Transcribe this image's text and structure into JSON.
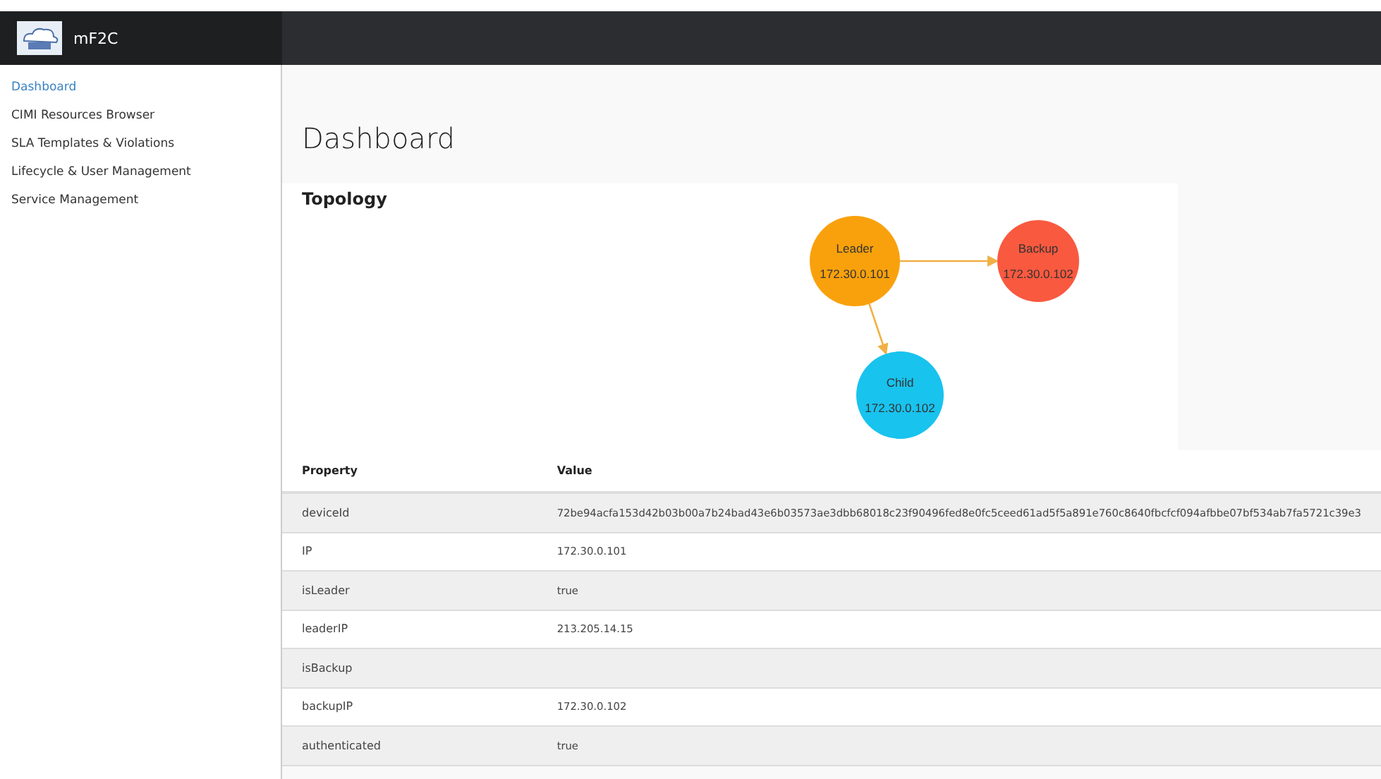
{
  "app": {
    "title": "mF2C"
  },
  "sidebar": {
    "items": [
      {
        "label": "Dashboard",
        "selected": true
      },
      {
        "label": "CIMI Resources Browser",
        "selected": false
      },
      {
        "label": "SLA Templates & Violations",
        "selected": false
      },
      {
        "label": "Lifecycle & User Management",
        "selected": false
      },
      {
        "label": "Service Management",
        "selected": false
      }
    ]
  },
  "page_title": "Dashboard",
  "topology": {
    "title": "Topology",
    "nodes": [
      {
        "kind": "leader",
        "label": "Leader",
        "ip": "172.30.0.101",
        "color": "#f9a10c"
      },
      {
        "kind": "backup",
        "label": "Backup",
        "ip": "172.30.0.102",
        "color": "#f9593f"
      },
      {
        "kind": "child",
        "label": "Child",
        "ip": "172.30.0.102",
        "color": "#18c3ee"
      }
    ]
  },
  "table": {
    "columns": [
      "Property",
      "Value"
    ],
    "rows": [
      [
        "deviceId",
        "72be94acfa153d42b03b00a7b24bad43e6b03573ae3dbb68018c23f90496fed8e0fc5ceed61ad5f5a891e760c8640fbcfcf094afbbe07bf534ab7fa5721c39e3"
      ],
      [
        "IP",
        "172.30.0.101"
      ],
      [
        "isLeader",
        "true"
      ],
      [
        "leaderIP",
        "213.205.14.15"
      ],
      [
        "isBackup",
        ""
      ],
      [
        "backupIP",
        "172.30.0.102"
      ],
      [
        "authenticated",
        "true"
      ]
    ]
  }
}
